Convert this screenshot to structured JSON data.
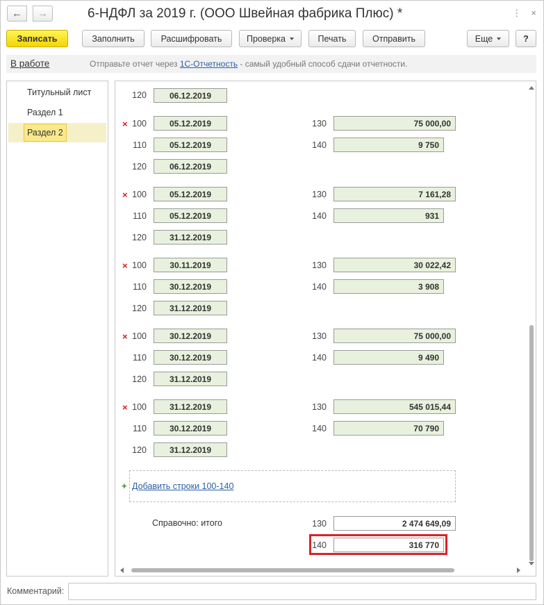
{
  "window": {
    "title": "6-НДФЛ за 2019 г. (ООО Швейная фабрика Плюс) *",
    "nav_back_icon": "arrow-left",
    "nav_forward_icon": "arrow-right",
    "more_icon": "⋮",
    "close_icon": "×"
  },
  "toolbar": {
    "save": "Записать",
    "fill": "Заполнить",
    "decode": "Расшифровать",
    "check": "Проверка",
    "print": "Печать",
    "send": "Отправить",
    "more": "Еще",
    "help": "?"
  },
  "infobar": {
    "status": "В работе",
    "text_before": "Отправьте отчет через ",
    "link": "1С-Отчетность",
    "text_after": " - самый удобный способ сдачи отчетности."
  },
  "sections": [
    {
      "label": "Титульный лист",
      "selected": false
    },
    {
      "label": "Раздел 1",
      "selected": false
    },
    {
      "label": "Раздел 2",
      "selected": true
    }
  ],
  "top_row": {
    "code": "120",
    "value": "06.12.2019"
  },
  "blocks": [
    {
      "r100": "05.12.2019",
      "r110": "05.12.2019",
      "r120": "06.12.2019",
      "r130": "75 000,00",
      "r140": "9 750"
    },
    {
      "r100": "05.12.2019",
      "r110": "05.12.2019",
      "r120": "31.12.2019",
      "r130": "7 161,28",
      "r140": "931"
    },
    {
      "r100": "30.11.2019",
      "r110": "30.12.2019",
      "r120": "31.12.2019",
      "r130": "30 022,42",
      "r140": "3 908"
    },
    {
      "r100": "30.12.2019",
      "r110": "30.12.2019",
      "r120": "31.12.2019",
      "r130": "75 000,00",
      "r140": "9 490"
    },
    {
      "r100": "31.12.2019",
      "r110": "30.12.2019",
      "r120": "31.12.2019",
      "r130": "545 015,44",
      "r140": "70 790"
    }
  ],
  "codes": {
    "c100": "100",
    "c110": "110",
    "c120": "120",
    "c130": "130",
    "c140": "140"
  },
  "delete_mark": "×",
  "add_rows": {
    "plus": "+",
    "label": "Добавить строки 100-140"
  },
  "totals": {
    "label": "Справочно: итого",
    "c130": "130",
    "v130": "2 474 649,09",
    "c140": "140",
    "v140": "316 770"
  },
  "comment": {
    "label": "Комментарий:",
    "value": ""
  },
  "colors": {
    "field_bg": "#e8f1dd",
    "highlight": "#d8232a",
    "primary": "#f3d600"
  }
}
